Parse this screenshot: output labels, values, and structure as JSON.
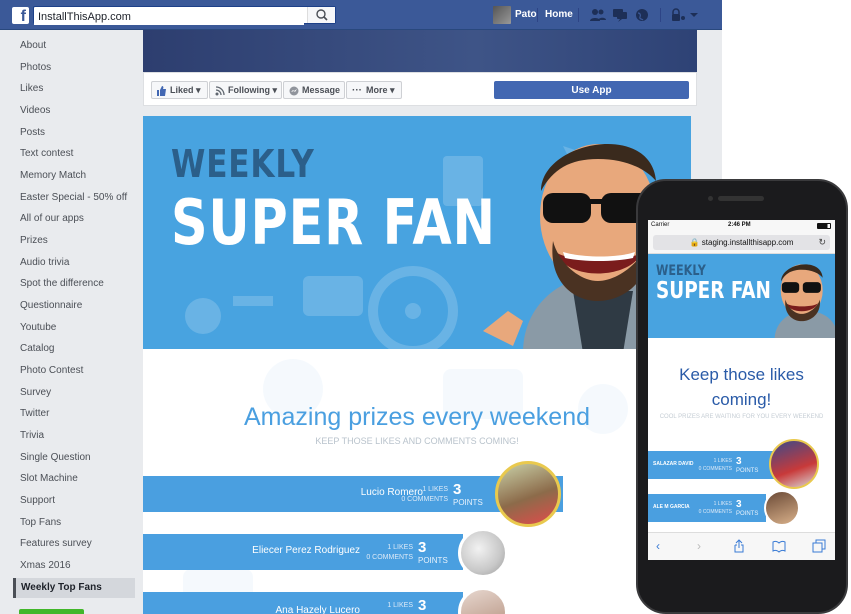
{
  "topbar": {
    "search_value": "InstallThisApp.com",
    "user_name": "Pato",
    "home_label": "Home",
    "colors": {
      "bar": "#3b5998"
    }
  },
  "sidebar": {
    "items": [
      {
        "label": "About"
      },
      {
        "label": "Photos"
      },
      {
        "label": "Likes"
      },
      {
        "label": "Videos"
      },
      {
        "label": "Posts"
      },
      {
        "label": "Text contest"
      },
      {
        "label": "Memory Match"
      },
      {
        "label": "Easter Special - 50% off"
      },
      {
        "label": "All of our apps"
      },
      {
        "label": "Prizes"
      },
      {
        "label": "Audio trivia"
      },
      {
        "label": "Spot the difference"
      },
      {
        "label": "Questionnaire"
      },
      {
        "label": "Youtube"
      },
      {
        "label": "Catalog"
      },
      {
        "label": "Photo Contest"
      },
      {
        "label": "Survey"
      },
      {
        "label": "Twitter"
      },
      {
        "label": "Trivia"
      },
      {
        "label": "Single Question"
      },
      {
        "label": "Slot Machine"
      },
      {
        "label": "Support"
      },
      {
        "label": "Top Fans"
      },
      {
        "label": "Features survey"
      },
      {
        "label": "Xmas 2016"
      },
      {
        "label": "Weekly Top Fans"
      }
    ]
  },
  "actions": {
    "liked": "Liked",
    "following": "Following",
    "message": "Message",
    "more": "More",
    "use_app": "Use App"
  },
  "app": {
    "banner_line1": "WEEKLY",
    "banner_line2": "SUPER FAN",
    "headline": "Amazing prizes every weekend",
    "subline": "KEEP THOSE LIKES AND COMMENTS COMING!",
    "fans": [
      {
        "name": "Lucio Romero",
        "likes": "1 LIKES",
        "comments": "0 COMMENTS",
        "points": "3",
        "points_label": "POINTS"
      },
      {
        "name": "Eliecer Perez Rodriguez",
        "likes": "1 LIKES",
        "comments": "0 COMMENTS",
        "points": "3",
        "points_label": "POINTS"
      },
      {
        "name": "Ana Hazely Lucero",
        "likes": "1 LIKES",
        "comments": "",
        "points": "3",
        "points_label": ""
      }
    ],
    "colors": {
      "banner": "#48a3e0",
      "row": "#4a9fe0",
      "headline": "#4a9fe0"
    }
  },
  "phone": {
    "carrier": "Carrier",
    "time": "2:46 PM",
    "url": "staging.installthisapp.com",
    "banner_line1": "WEEKLY",
    "banner_line2": "SUPER FAN",
    "headline_line1": "Keep those likes",
    "headline_line2": "coming!",
    "subline": "COOL PRIZES ARE WAITING FOR YOU EVERY WEEKEND",
    "fans": [
      {
        "name": "SALAZAR DAVID",
        "likes": "1 LIKES",
        "comments": "0 COMMENTS",
        "points": "3",
        "points_label": "POINTS"
      },
      {
        "name": "ALE M GARCIA",
        "likes": "1 LIKES",
        "comments": "0 COMMENTS",
        "points": "3",
        "points_label": "POINTS"
      }
    ]
  }
}
